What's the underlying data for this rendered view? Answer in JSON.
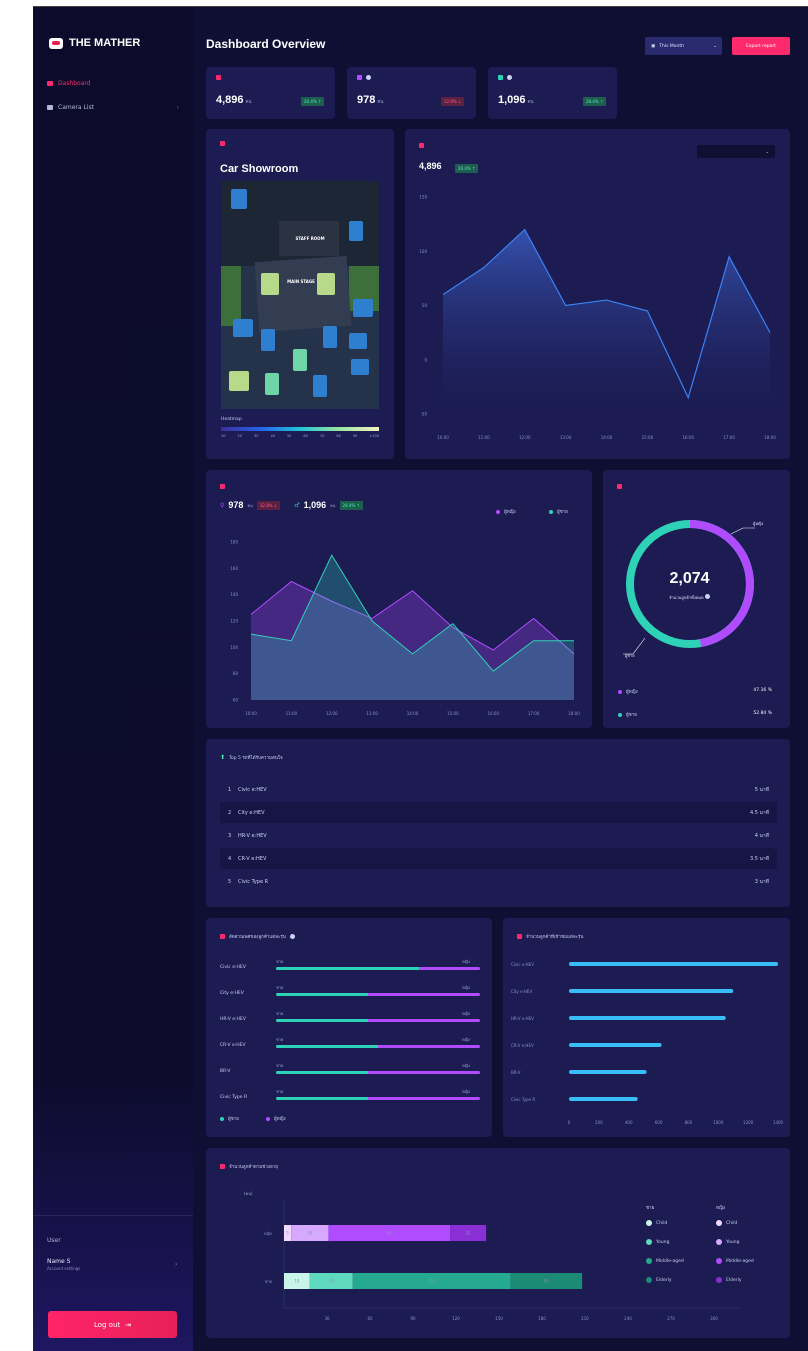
{
  "brand": {
    "name": "THE MATHER"
  },
  "sidebar": {
    "items": [
      {
        "label": "Dashboard",
        "active": true
      },
      {
        "label": "Camera List",
        "active": false
      }
    ],
    "user_label": "User",
    "user_name": "Name S",
    "user_sub": "Account settings",
    "logout_label": "Log out"
  },
  "header": {
    "title": "Dashboard Overview",
    "filter_label": "This Month",
    "export_label": "Export report"
  },
  "stats": [
    {
      "value": "4,896",
      "unit": "คน",
      "color": "#ff2a6d",
      "badge": "20.4% ↑",
      "trend": "up"
    },
    {
      "value": "978",
      "unit": "คน",
      "color": "#b04cff",
      "badge": "12.8% ↓",
      "trend": "down"
    },
    {
      "value": "1,096",
      "unit": "คน",
      "color": "#2ed3b7",
      "badge": "28.4% ↑",
      "trend": "up"
    }
  ],
  "map_card": {
    "title": "Car Showroom",
    "map_labels": {
      "staff": "STAFF ROOM",
      "stage": "MAIN STAGE"
    },
    "scale_label": "Heatmap",
    "scale_ticks": [
      "10",
      "20",
      "30",
      "40",
      "50",
      "60",
      "70",
      "80",
      "90",
      ">100"
    ]
  },
  "traffic_card": {
    "value": "4,896",
    "badge": "20.4% ↑",
    "chart_data": {
      "type": "area",
      "x": [
        "10:00",
        "11:00",
        "12:00",
        "13:00",
        "14:00",
        "15:00",
        "16:00",
        "17:00",
        "18:00"
      ],
      "values": [
        60,
        85,
        120,
        50,
        55,
        45,
        -35,
        95,
        25
      ],
      "ylim": [
        -50,
        150
      ],
      "yticks": [
        "150",
        "100",
        "50",
        "0",
        "-50"
      ],
      "color": "#3b82f6"
    }
  },
  "gender_trend": {
    "female_value": "978",
    "female_unit": "คน",
    "female_badge": "12.8% ↓",
    "male_value": "1,096",
    "male_unit": "คน",
    "male_badge": "28.4% ↑",
    "chart_data": {
      "type": "area",
      "x": [
        "10:00",
        "11:00",
        "12:00",
        "13:00",
        "14:00",
        "15:00",
        "16:00",
        "17:00",
        "18:00"
      ],
      "yticks": [
        "180",
        "160",
        "140",
        "120",
        "100",
        "80",
        "60"
      ],
      "ylim": [
        60,
        180
      ],
      "series": [
        {
          "values": [
            125,
            150,
            135,
            122,
            143,
            115,
            98,
            122,
            95
          ],
          "color": "#b04cff"
        },
        {
          "values": [
            110,
            105,
            170,
            120,
            95,
            118,
            82,
            105,
            105
          ],
          "color": "#2ed3b7"
        }
      ]
    }
  },
  "donut": {
    "total": "2,074",
    "subtitle": "จำนวนลูกค้าทั้งหมด",
    "female_label": "ผู้หญิง",
    "male_label": "ผู้ชาย",
    "female_pct": "47.16 %",
    "male_pct": "52.84 %",
    "female_fraction": 0.4716,
    "male_color": "#2ed3b7",
    "female_color": "#b04cff"
  },
  "top5": {
    "title": "Top 5 รถที่ได้รับความสนใจ",
    "rows": [
      {
        "rank": "1",
        "name": "Civic e:HEV",
        "value": "5 นาที"
      },
      {
        "rank": "2",
        "name": "City e:HEV",
        "value": "4.5 นาที"
      },
      {
        "rank": "3",
        "name": "HR-V e:HEV",
        "value": "4 นาที"
      },
      {
        "rank": "4",
        "name": "CR-V e:HEV",
        "value": "3.5 นาที"
      },
      {
        "rank": "5",
        "name": "Civic Type R",
        "value": "3 นาที"
      }
    ]
  },
  "gender_by_car": {
    "title": "สัดส่วนเพศของลูกค้าแต่ละรุ่น",
    "left_label": "ชาย",
    "right_label": "หญิง",
    "rows": [
      {
        "name": "Civic e:HEV",
        "male": 0.7
      },
      {
        "name": "City e:HEV",
        "male": 0.45
      },
      {
        "name": "HR-V e:HEV",
        "male": 0.45
      },
      {
        "name": "CR-V e:HEV",
        "male": 0.5
      },
      {
        "name": "BR-V",
        "male": 0.45
      },
      {
        "name": "Civic Type R",
        "male": 0.45
      }
    ],
    "legend": [
      {
        "label": "ผู้ชาย",
        "color": "#2ed3b7"
      },
      {
        "label": "ผู้หญิง",
        "color": "#b04cff"
      }
    ]
  },
  "visits_by_car": {
    "title": "จำนวนลูกค้าที่เข้าชมแต่ละรุ่น",
    "chart_data": {
      "type": "bar",
      "categories": [
        "Civic e:HEV",
        "City e:HEV",
        "HR-V e:HEV",
        "CR-V e:HEV",
        "BR-V",
        "Civic Type R"
      ],
      "values": [
        1400,
        1100,
        1050,
        620,
        520,
        460
      ],
      "xlim": [
        0,
        1400
      ],
      "xticks": [
        "0",
        "200",
        "400",
        "600",
        "800",
        "1000",
        "1200",
        "1400"
      ],
      "color": "#38bdf8"
    }
  },
  "age_chart": {
    "title": "จำนวนลูกค้าตามช่วงอายุ",
    "unit_label": "(คน)",
    "chart_data": {
      "type": "bar",
      "categories": [
        "หญิง",
        "ชาย"
      ],
      "xticks": [
        "30",
        "60",
        "90",
        "120",
        "150",
        "180",
        "210",
        "240",
        "270",
        "300"
      ],
      "xlim": [
        0,
        300
      ],
      "rows": [
        {
          "segments": [
            {
              "label": "5",
              "value": 5,
              "color": "#f3d9ff"
            },
            {
              "label": "26",
              "value": 26,
              "color": "#d6a9ff"
            },
            {
              "label": "85",
              "value": 85,
              "color": "#b04cff"
            },
            {
              "label": "25",
              "value": 25,
              "color": "#8a2ed6"
            }
          ]
        },
        {
          "segments": [
            {
              "label": "18",
              "value": 18,
              "color": "#c9f5e9"
            },
            {
              "label": "30",
              "value": 30,
              "color": "#5fd9be"
            },
            {
              "label": "110",
              "value": 110,
              "color": "#25a98f"
            },
            {
              "label": "50",
              "value": 50,
              "color": "#1d8a75"
            }
          ]
        }
      ]
    },
    "legend_male_title": "ชาย",
    "legend_female_title": "หญิง",
    "legend_male": [
      {
        "label": "Child",
        "color": "#c9f5e9"
      },
      {
        "label": "Young",
        "color": "#5fd9be"
      },
      {
        "label": "Middle-aged",
        "color": "#25a98f"
      },
      {
        "label": "Elderly",
        "color": "#1d8a75"
      }
    ],
    "legend_female": [
      {
        "label": "Child",
        "color": "#f3d9ff"
      },
      {
        "label": "Young",
        "color": "#d6a9ff"
      },
      {
        "label": "Middle-aged",
        "color": "#b04cff"
      },
      {
        "label": "Elderly",
        "color": "#8a2ed6"
      }
    ]
  }
}
